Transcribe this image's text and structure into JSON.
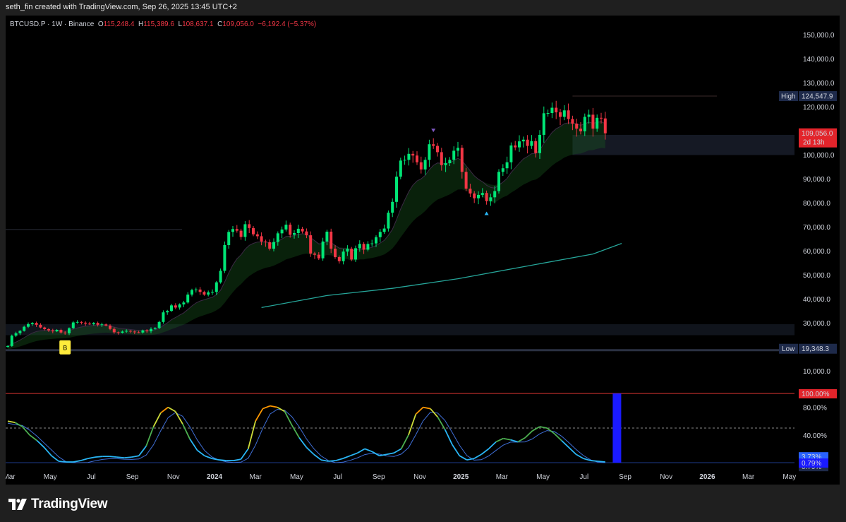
{
  "credit": "seth_fin created with TradingView.com, Sep 26, 2025 13:45 UTC+2",
  "symbol": "BTCUSD.P · 1W · Binance",
  "ohlc": {
    "o_label": "O",
    "o": "115,248.4",
    "h_label": "H",
    "h": "115,389.6",
    "l_label": "L",
    "l": "108,637.1",
    "c_label": "C",
    "c": "109,056.0",
    "change": "−6,192.4 (−5.37%)"
  },
  "brand": "TradingView",
  "colors": {
    "up": "#00e676",
    "down": "#f23645",
    "ma": "#26a69a",
    "background": "#000000"
  },
  "chart_data": {
    "type": "candlestick",
    "price_axis": [
      "150,000.0",
      "140,000.0",
      "130,000.0",
      "120,000.0",
      "110,000.0",
      "100,000.0",
      "90,000.0",
      "80,000.0",
      "70,000.0",
      "60,000.0",
      "50,000.0",
      "40,000.0",
      "30,000.0",
      "20,000.0",
      "10,000.0"
    ],
    "price_ticks": [
      150000,
      140000,
      130000,
      120000,
      110000,
      100000,
      90000,
      80000,
      70000,
      60000,
      50000,
      40000,
      30000,
      20000,
      10000
    ],
    "y_range": [
      10000,
      150000
    ],
    "time_axis": [
      "Mar",
      "May",
      "Jul",
      "Sep",
      "Nov",
      "2024",
      "Mar",
      "May",
      "Jul",
      "Sep",
      "Nov",
      "2025",
      "Mar",
      "May",
      "Jul",
      "Sep",
      "Nov",
      "2026",
      "Mar",
      "May"
    ],
    "high_marker": {
      "label": "High",
      "value": "124,547.9",
      "price": 124547.9
    },
    "low_marker": {
      "label": "Low",
      "value": "19,348.3",
      "price": 19348.3
    },
    "last_price": {
      "value": "109,056.0",
      "countdown": "2d 13h",
      "price": 109056
    },
    "signal_marker": "B",
    "closes": [
      20500,
      24800,
      25800,
      26800,
      28500,
      29600,
      30100,
      29300,
      28200,
      27500,
      27000,
      26600,
      27200,
      26100,
      25800,
      27900,
      30300,
      30500,
      30200,
      29800,
      29600,
      30100,
      29300,
      29500,
      29000,
      27600,
      26200,
      26000,
      26500,
      26800,
      26500,
      26200,
      26100,
      27000,
      26600,
      27600,
      28000,
      30500,
      34500,
      35100,
      37400,
      36500,
      37800,
      38600,
      41900,
      43800,
      44000,
      43000,
      41900,
      42800,
      43000,
      47000,
      51800,
      62500,
      68000,
      69200,
      68500,
      65900,
      71200,
      69600,
      67000,
      66200,
      64000,
      63700,
      61000,
      63800,
      67400,
      69000,
      71000,
      66800,
      67500,
      69300,
      68200,
      66600,
      59000,
      58500,
      57000,
      64000,
      68100,
      61000,
      57500,
      55800,
      59800,
      61000,
      56500,
      61200,
      63000,
      60600,
      63000,
      63200,
      65800,
      68000,
      69400,
      76000,
      80500,
      91000,
      97700,
      98000,
      100500,
      99800,
      97000,
      94000,
      98000,
      104500,
      103800,
      101200,
      95800,
      96600,
      98000,
      101800,
      103000,
      93000,
      86000,
      84000,
      82000,
      83400,
      84200,
      80800,
      82400,
      85000,
      93000,
      94500,
      97000,
      104000,
      103200,
      105700,
      106400,
      103800,
      105800,
      100800,
      108400,
      117400,
      117500,
      119700,
      117800,
      115900,
      118600,
      115000,
      113100,
      111000,
      109900,
      115900,
      116800,
      111000,
      115500,
      115248,
      109056
    ],
    "ema_slow": [
      {
        "week": 62,
        "value": 36500
      },
      {
        "week": 78,
        "value": 41500
      },
      {
        "week": 94,
        "value": 44500
      },
      {
        "week": 110,
        "value": 48500
      },
      {
        "week": 126,
        "value": 53500
      },
      {
        "week": 143,
        "value": 58800
      },
      {
        "week": 150,
        "value": 63200
      }
    ],
    "oscillator": {
      "scale": [
        "100.00%",
        "80.00%",
        "40.00%",
        "3.73%",
        "0.79%",
        "0.79%"
      ],
      "levels": [
        100,
        80,
        40,
        3.73,
        0.79
      ],
      "current": "3.73%",
      "k": [
        60,
        58,
        52,
        40,
        32,
        22,
        10,
        2,
        1,
        1,
        3,
        6,
        8,
        9,
        9,
        8,
        7,
        8,
        10,
        24,
        52,
        72,
        80,
        74,
        56,
        34,
        18,
        10,
        6,
        4,
        3,
        3,
        5,
        20,
        60,
        78,
        82,
        80,
        74,
        54,
        36,
        22,
        12,
        4,
        2,
        3,
        6,
        10,
        14,
        20,
        16,
        10,
        12,
        14,
        20,
        40,
        70,
        80,
        78,
        66,
        48,
        26,
        10,
        4,
        6,
        12,
        20,
        30,
        35,
        33,
        30,
        36,
        46,
        52,
        50,
        42,
        32,
        22,
        12,
        6,
        3,
        2,
        1
      ]
    }
  }
}
